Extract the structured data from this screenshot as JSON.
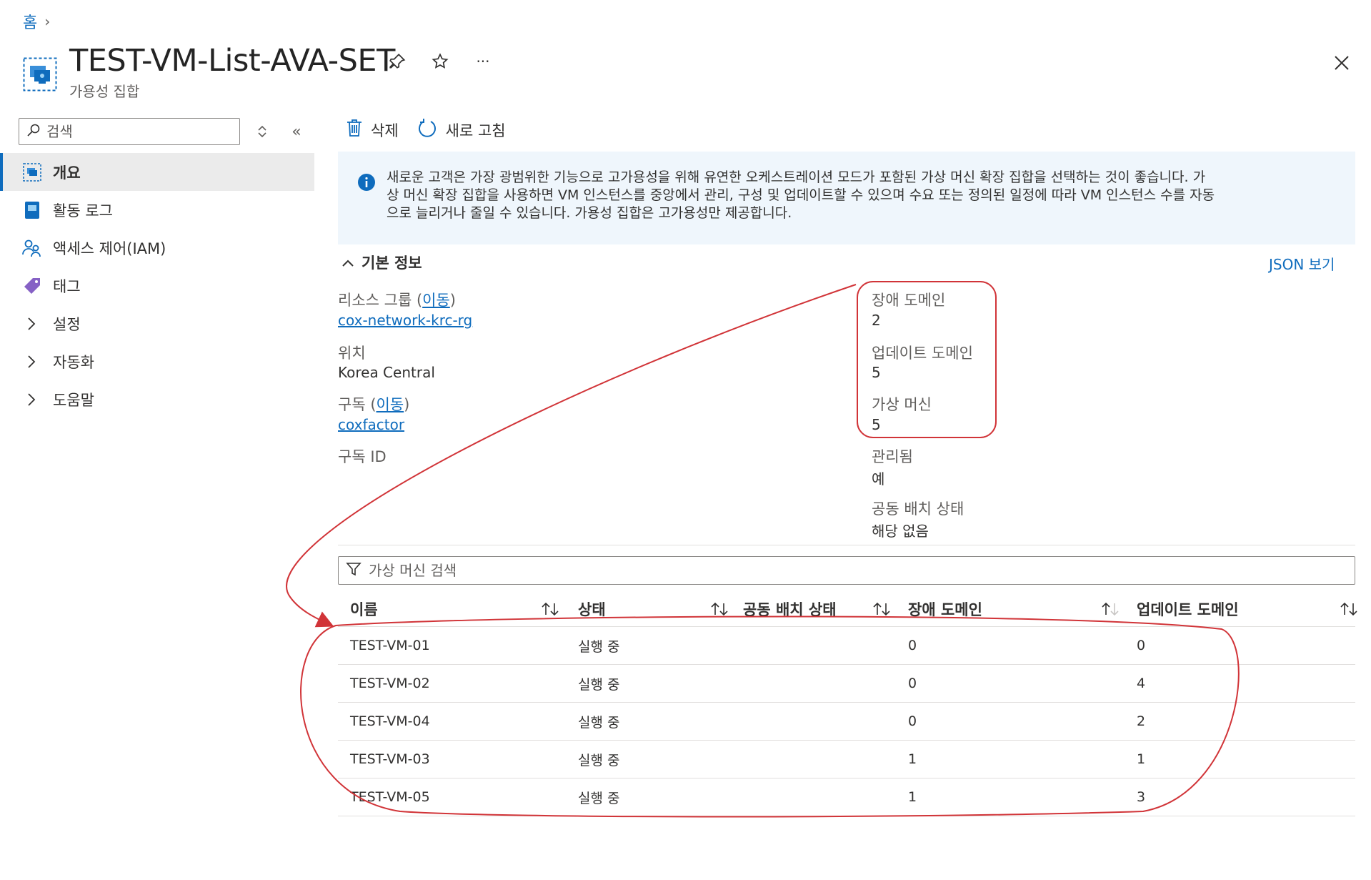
{
  "breadcrumb": {
    "home": "홈",
    "separator": "›"
  },
  "header": {
    "title": "TEST-VM-List-AVA-SET",
    "subtitle": "가용성 집합",
    "resource_icon": "availability-set-icon",
    "actions": [
      "pin-icon",
      "star-icon",
      "more-icon"
    ],
    "ellipsis": "···",
    "close_icon": "close-icon"
  },
  "sidebar": {
    "search_placeholder": "검색",
    "collapse_glyph": "«",
    "items": [
      {
        "label": "개요",
        "icon": "overview-icon",
        "active": true
      },
      {
        "label": "활동 로그",
        "icon": "activity-log-icon"
      },
      {
        "label": "액세스 제어(IAM)",
        "icon": "iam-icon"
      },
      {
        "label": "태그",
        "icon": "tag-icon"
      },
      {
        "label": "설정",
        "icon": "chevron-right-icon"
      },
      {
        "label": "자동화",
        "icon": "chevron-right-icon"
      },
      {
        "label": "도움말",
        "icon": "chevron-right-icon"
      }
    ]
  },
  "toolbar": {
    "delete_label": "삭제",
    "refresh_label": "새로 고침"
  },
  "info_banner": {
    "line1": "새로운 고객은 가장 광범위한 기능으로 고가용성을 위해 유연한 오케스트레이션 모드가 포함된 가상 머신 확장 집합을 선택하는 것이 좋습니다. 가",
    "line2": "상 머신 확장 집합을 사용하면 VM 인스턴스를 중앙에서 관리, 구성 및 업데이트할 수 있으며 수요 또는 정의된 일정에 따라 VM 인스턴스 수를 자동",
    "line3": "으로 늘리거나 줄일 수 있습니다. 가용성 집합은 고가용성만 제공합니다."
  },
  "essentials": {
    "title": "기본 정보",
    "json_link": "JSON 보기",
    "move_link": "이동",
    "resource_group_label": "리소스 그룹",
    "resource_group_value": "cox-network-krc-rg",
    "location_label": "위치",
    "location_value": "Korea Central",
    "subscription_label": "구독",
    "subscription_value": "coxfactor",
    "subscription_id_label": "구독 ID",
    "subscription_id_value": "",
    "fault_domain_label": "장애 도메인",
    "fault_domain_value": "2",
    "update_domain_label": "업데이트 도메인",
    "update_domain_value": "5",
    "vm_label": "가상 머신",
    "vm_value": "5",
    "managed_label": "관리됨",
    "managed_value": "예",
    "ppg_label": "공동 배치 상태",
    "ppg_value": "해당 없음"
  },
  "vm_filter": {
    "placeholder": "가상 머신 검색"
  },
  "vm_table": {
    "columns": [
      "이름",
      "상태",
      "공동 배치 상태",
      "장애 도메인",
      "업데이트 도메인"
    ],
    "rows": [
      {
        "name": "TEST-VM-01",
        "status": "실행 중",
        "ppg": "",
        "fault": "0",
        "update": "0"
      },
      {
        "name": "TEST-VM-02",
        "status": "실행 중",
        "ppg": "",
        "fault": "0",
        "update": "4"
      },
      {
        "name": "TEST-VM-04",
        "status": "실행 중",
        "ppg": "",
        "fault": "0",
        "update": "2"
      },
      {
        "name": "TEST-VM-03",
        "status": "실행 중",
        "ppg": "",
        "fault": "1",
        "update": "1"
      },
      {
        "name": "TEST-VM-05",
        "status": "실행 중",
        "ppg": "",
        "fault": "1",
        "update": "3"
      }
    ]
  },
  "colors": {
    "accent": "#0f6cbd",
    "annotation": "#d13438",
    "banner_bg": "#eff6fc",
    "active_nav_bg": "#ebebeb"
  }
}
